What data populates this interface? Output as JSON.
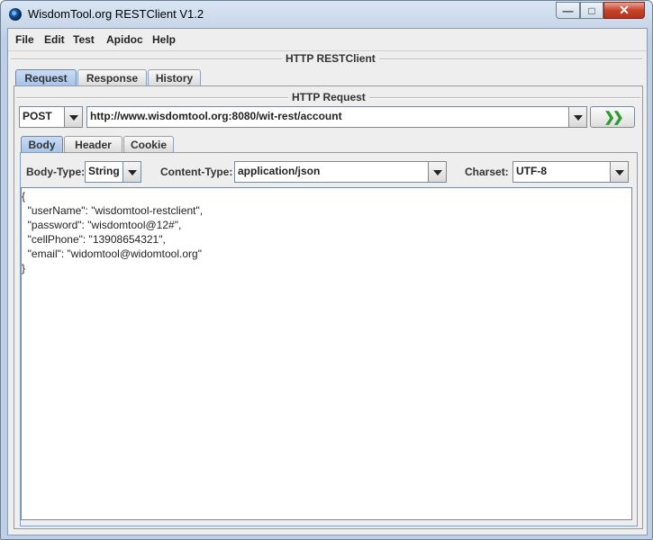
{
  "window": {
    "title": "WisdomTool.org RESTClient V1.2"
  },
  "menu": [
    "File",
    "Edit",
    "Test",
    "Apidoc",
    "Help"
  ],
  "main": {
    "group_title": "HTTP RESTClient",
    "tabs": [
      "Request",
      "Response",
      "History"
    ],
    "active_tab": "Request"
  },
  "request": {
    "group_title": "HTTP Request",
    "method": "POST",
    "url": "http://www.wisdomtool.org:8080/wit-rest/account",
    "subtabs": [
      "Body",
      "Header",
      "Cookie"
    ],
    "active_subtab": "Body",
    "body_type_label": "Body-Type:",
    "body_type_value": "String",
    "content_type_label": "Content-Type:",
    "content_type_value": "application/json",
    "charset_label": "Charset:",
    "charset_value": "UTF-8",
    "body_lines": [
      "{",
      "  \"userName\": \"wisdomtool-restclient\",",
      "  \"password\": \"wisdomtool@12#\",",
      "  \"cellPhone\": \"13908654321\",",
      "  \"email\": \"widomtool@widomtool.org\"",
      "}"
    ]
  },
  "icons": {
    "app": "app-logo-icon",
    "send": "send-arrows-icon",
    "minimize": "minimize-icon",
    "maximize": "maximize-icon",
    "close": "close-icon"
  }
}
